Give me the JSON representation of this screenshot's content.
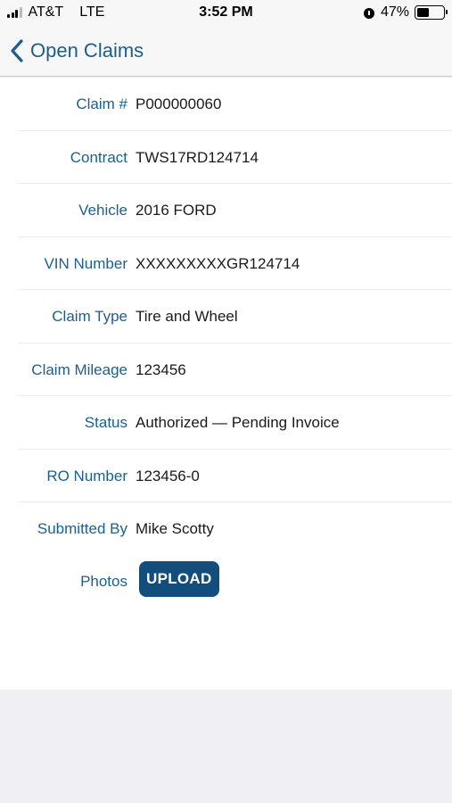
{
  "status_bar": {
    "carrier": "AT&T",
    "network": "LTE",
    "time": "3:52 PM",
    "battery_percent": "47%",
    "battery_level": 0.47
  },
  "nav": {
    "back_label": "Open Claims"
  },
  "claim": {
    "rows": [
      {
        "label": "Claim #",
        "value": "P000000060"
      },
      {
        "label": "Contract",
        "value": "TWS17RD124714"
      },
      {
        "label": "Vehicle",
        "value": "2016 FORD"
      },
      {
        "label": "VIN Number",
        "value": "XXXXXXXXXGR124714"
      },
      {
        "label": "Claim Type",
        "value": "Tire and Wheel"
      },
      {
        "label": "Claim Mileage",
        "value": "123456"
      },
      {
        "label": "Status",
        "value": "Authorized — Pending Invoice"
      },
      {
        "label": "RO Number",
        "value": "123456-0"
      },
      {
        "label": "Submitted By",
        "value": "Mike Scotty"
      }
    ],
    "photos_label": "Photos",
    "upload_label": "UPLOAD"
  },
  "colors": {
    "accent": "#1d5f8c",
    "button": "#134d7b"
  }
}
